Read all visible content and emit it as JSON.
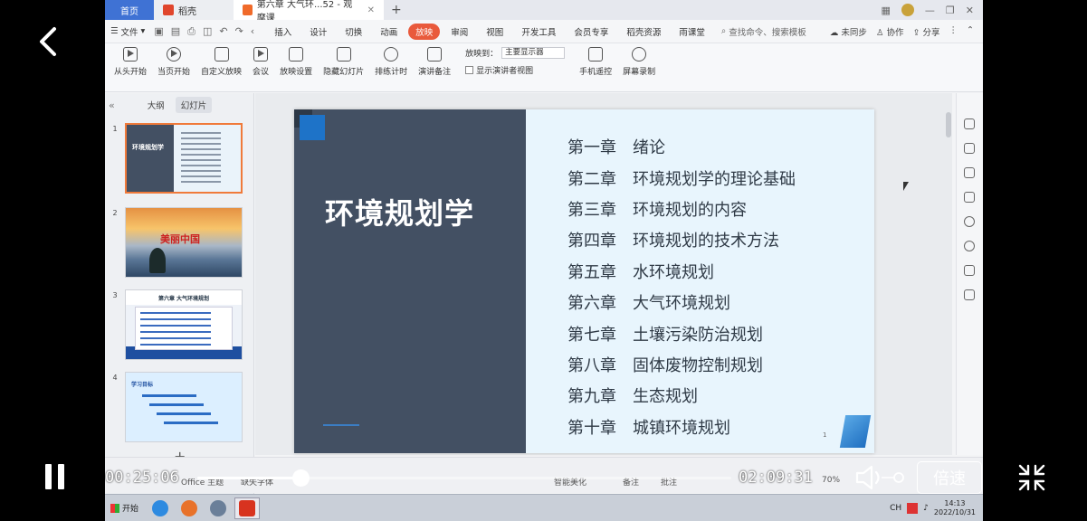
{
  "tabs": {
    "home": "首页",
    "wps": "稻壳",
    "doc": "第六章 大气环...52 - 观摩课"
  },
  "menu": {
    "file": "文件",
    "items": [
      "插入",
      "设计",
      "切换",
      "动画",
      "放映",
      "审阅",
      "视图",
      "开发工具",
      "会员专享",
      "稻壳资源",
      "雨课堂"
    ],
    "active_index": 4,
    "search": "查找命令、搜索模板",
    "sync": "未同步",
    "collab": "协作",
    "share": "分享"
  },
  "ribbon": {
    "buttons": [
      "从头开始",
      "当页开始",
      "自定义放映",
      "会议",
      "放映设置",
      "隐藏幻灯片",
      "排练计时",
      "演讲备注"
    ],
    "play_to_label": "放映到：",
    "play_to_value": "主要显示器",
    "presenter_view": "显示演讲者视图",
    "phone_remote": "手机遥控",
    "screen_record": "屏幕录制"
  },
  "left_panel": {
    "tab_outline": "大纲",
    "tab_slides": "幻灯片",
    "slides": [
      {
        "num": "1",
        "title": "环境规划学"
      },
      {
        "num": "2",
        "title": "美丽中国"
      },
      {
        "num": "3",
        "title": "第六章 大气环境规划"
      },
      {
        "num": "4",
        "title": "学习目标"
      }
    ],
    "add": "+"
  },
  "slide": {
    "title": "环境规划学",
    "page": "1",
    "toc": [
      {
        "num": "第一章",
        "name": "绪论"
      },
      {
        "num": "第二章",
        "name": "环境规划学的理论基础"
      },
      {
        "num": "第三章",
        "name": "环境规划的内容"
      },
      {
        "num": "第四章",
        "name": "环境规划的技术方法"
      },
      {
        "num": "第五章",
        "name": "水环境规划"
      },
      {
        "num": "第六章",
        "name": "大气环境规划"
      },
      {
        "num": "第七章",
        "name": "土壤污染防治规划"
      },
      {
        "num": "第八章",
        "name": "固体废物控制规划"
      },
      {
        "num": "第九章",
        "name": "生态规划"
      },
      {
        "num": "第十章",
        "name": "城镇环境规划"
      }
    ]
  },
  "statusbar": {
    "theme": "Office 主题",
    "font": "缺失字体",
    "beautify": "智能美化",
    "notes": "备注",
    "comment": "批注",
    "zoom": "70%"
  },
  "taskbar": {
    "start": "开始",
    "ime": "CH",
    "time": "14:13",
    "date": "2022/10/31"
  },
  "player": {
    "elapsed": "00:25:06",
    "duration": "02:09:31",
    "progress": 0.194,
    "speed": "倍速"
  }
}
